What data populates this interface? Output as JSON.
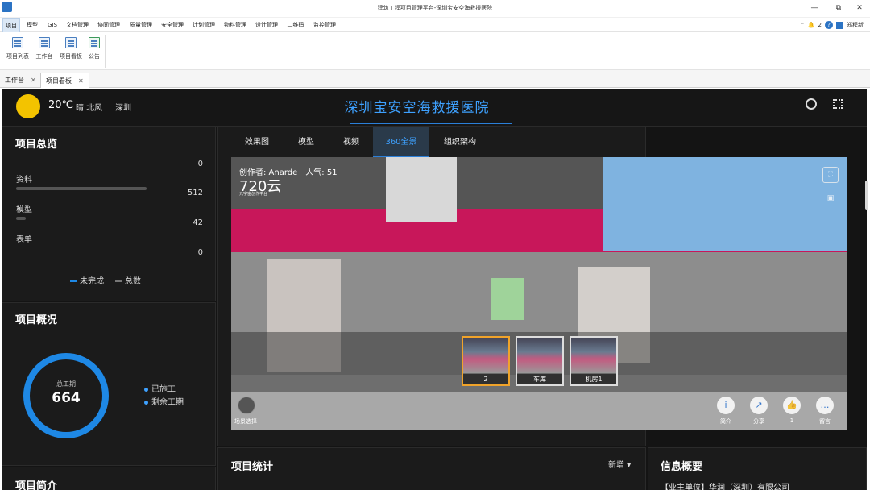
{
  "window": {
    "title": "建筑工程项目管理平台-深圳宝安空海救援医院",
    "controls": [
      "—",
      "⧉",
      "✕"
    ]
  },
  "menu": {
    "items": [
      "项目",
      "模型",
      "GIS",
      "文档管理",
      "协同管理",
      "质量管理",
      "安全管理",
      "计划管理",
      "物料管理",
      "设计管理",
      "二维码",
      "监控管理"
    ],
    "notifications": "2",
    "username": "郑程新"
  },
  "ribbon": {
    "items": [
      "项目列表",
      "工作台",
      "项目看板",
      "公告"
    ]
  },
  "doc_tabs": [
    {
      "label": "工作台"
    },
    {
      "label": "项目看板"
    }
  ],
  "dashboard": {
    "weather": {
      "temp": "20℃",
      "desc": "晴 北风",
      "city": "深圳"
    },
    "title": "深圳宝安空海救援医院",
    "overview": {
      "title": "项目总览",
      "top_value": "0",
      "rows": [
        {
          "name": "资料",
          "value": "512",
          "bar_fraction": 0.8
        },
        {
          "name": "模型",
          "value": "42",
          "bar_fraction": 0.06
        },
        {
          "name": "表单",
          "value": "0",
          "bar_fraction": 0
        }
      ],
      "legend": [
        "未完成",
        "总数"
      ],
      "colors": {
        "incomplete": "#1e88e5",
        "total": "#777777"
      }
    },
    "general": {
      "title": "项目概况",
      "ring_label": "总工期",
      "ring_value": "664",
      "legend": [
        "已施工",
        "剩余工期"
      ]
    },
    "intro": {
      "title": "项目简介"
    },
    "view_tabs": [
      "效果图",
      "模型",
      "视频",
      "360全景",
      "组织架构"
    ],
    "active_tab": "360全景",
    "pano": {
      "author": "创作者: Anarde　人气: 51",
      "brand": "720云",
      "brand_sub": "元宇宙创作平台",
      "scenes": [
        "2",
        "车库",
        "机房1"
      ],
      "scene_select": "场景选择",
      "actions": [
        {
          "icon": "i",
          "label": "简介"
        },
        {
          "icon": "↗",
          "label": "分享"
        },
        {
          "icon": "👍",
          "label": "1"
        },
        {
          "icon": "…",
          "label": "留言"
        }
      ]
    },
    "stats": {
      "title": "项目统计",
      "new_label": "新增 ▾"
    },
    "info": {
      "title": "信息概要",
      "owner": "【业主单位】华润（深圳）有限公司"
    }
  }
}
